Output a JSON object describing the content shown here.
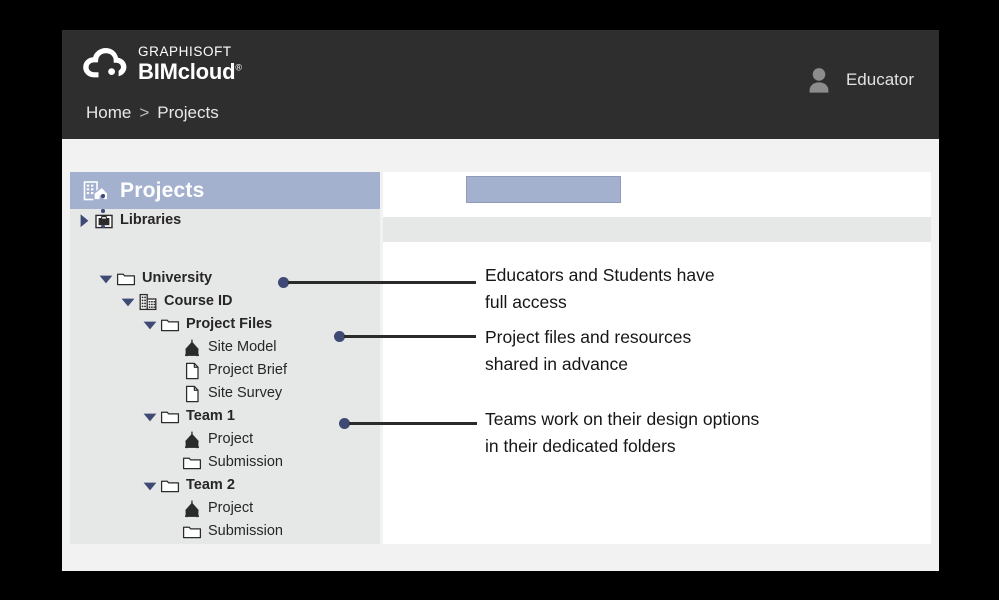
{
  "header": {
    "brand_top": "GRAPHISOFT",
    "brand_main": "BIMcloud",
    "brand_mark": "®",
    "logo_icon": "cloud-icon",
    "breadcrumb": {
      "home": "Home",
      "separator": ">",
      "current": "Projects"
    },
    "user": {
      "name": "Educator",
      "avatar_icon": "user-avatar-icon"
    }
  },
  "sidebar": {
    "title": "Projects",
    "title_icon": "projects-building-icon",
    "ellipsis_marker": "vertical-ellipsis",
    "tree": [
      {
        "label": "Libraries",
        "icon": "library-folder-icon",
        "twisty": "collapsed",
        "indent": 0,
        "bold": true
      },
      {
        "label": "University",
        "icon": "folder-icon",
        "twisty": "expanded",
        "indent": 1,
        "bold": true
      },
      {
        "label": "Course ID",
        "icon": "building-icon",
        "twisty": "expanded",
        "indent": 2,
        "bold": true
      },
      {
        "label": "Project Files",
        "icon": "folder-icon",
        "twisty": "expanded",
        "indent": 3,
        "bold": true
      },
      {
        "label": "Site Model",
        "icon": "model-house-icon",
        "twisty": "none",
        "indent": 4,
        "bold": false
      },
      {
        "label": "Project Brief",
        "icon": "document-icon",
        "twisty": "none",
        "indent": 4,
        "bold": false
      },
      {
        "label": "Site Survey",
        "icon": "document-icon",
        "twisty": "none",
        "indent": 4,
        "bold": false
      },
      {
        "label": "Team 1",
        "icon": "folder-icon",
        "twisty": "expanded",
        "indent": 3,
        "bold": true
      },
      {
        "label": "Project",
        "icon": "model-house-icon",
        "twisty": "none",
        "indent": 4,
        "bold": false
      },
      {
        "label": "Submission",
        "icon": "folder-icon",
        "twisty": "none",
        "indent": 4,
        "bold": false
      },
      {
        "label": "Team 2",
        "icon": "folder-icon",
        "twisty": "expanded",
        "indent": 3,
        "bold": true
      },
      {
        "label": "Project",
        "icon": "model-house-icon",
        "twisty": "none",
        "indent": 4,
        "bold": false
      },
      {
        "label": "Submission",
        "icon": "folder-icon",
        "twisty": "none",
        "indent": 4,
        "bold": false
      }
    ]
  },
  "content_panel": {
    "tab_label": "",
    "toolbar_label": ""
  },
  "callouts": [
    {
      "text": "Educators and Students have\nfull access",
      "target": "Course ID"
    },
    {
      "text": "Project files and resources\nshared in advance",
      "target": "Site Model"
    },
    {
      "text": "Teams work on their design options\nin their dedicated folders",
      "target": "Team 1 Project"
    }
  ],
  "colors": {
    "header_bg": "#2e2e2e",
    "accent_blue_gray": "#a3b1cf",
    "sidebar_bg": "#e6e7e7",
    "twisty_navy": "#3f4a74",
    "callout_line": "#2b2b2b",
    "page_bg": "#000000"
  }
}
